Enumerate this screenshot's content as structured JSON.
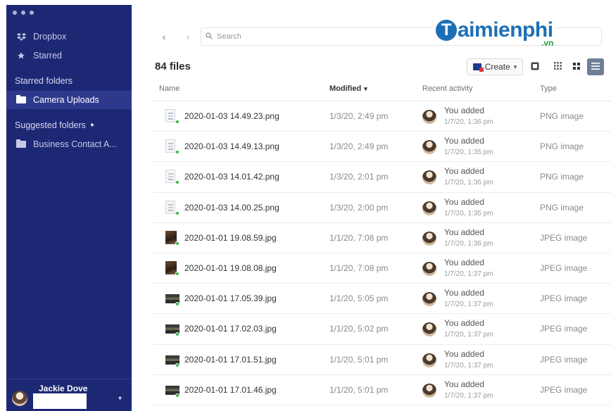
{
  "sidebar": {
    "items": [
      {
        "label": "Dropbox",
        "icon": "dropbox-icon"
      },
      {
        "label": "Starred",
        "icon": "star-icon"
      }
    ],
    "starred_header": "Starred folders",
    "starred_folders": [
      {
        "label": "Camera Uploads",
        "icon": "folder-icon"
      }
    ],
    "suggested_header": "Suggested folders",
    "suggested_folders": [
      {
        "label": "Business Contact A...",
        "icon": "folder-icon"
      }
    ],
    "user": {
      "name": "Jackie Dove"
    }
  },
  "toolbar": {
    "search_placeholder": "Search",
    "back_icon": "chevron-left-icon",
    "forward_icon": "chevron-right-icon"
  },
  "watermark": {
    "brand_rest": "aimienphi",
    "brand_letter": "T",
    "brand_sub": ".vn"
  },
  "header": {
    "file_count": "84 files",
    "create_label": "Create"
  },
  "columns": {
    "name": "Name",
    "modified": "Modified",
    "activity": "Recent activity",
    "type": "Type"
  },
  "files": [
    {
      "name": "2020-01-03 14.49.23.png",
      "modified": "1/3/20, 2:49 pm",
      "activity": "You added",
      "activity_time": "1/7/20, 1:36 pm",
      "type": "PNG image",
      "thumb": "doc"
    },
    {
      "name": "2020-01-03 14.49.13.png",
      "modified": "1/3/20, 2:49 pm",
      "activity": "You added",
      "activity_time": "1/7/20, 1:35 pm",
      "type": "PNG image",
      "thumb": "doc"
    },
    {
      "name": "2020-01-03 14.01.42.png",
      "modified": "1/3/20, 2:01 pm",
      "activity": "You added",
      "activity_time": "1/7/20, 1:36 pm",
      "type": "PNG image",
      "thumb": "doc"
    },
    {
      "name": "2020-01-03 14.00.25.png",
      "modified": "1/3/20, 2:00 pm",
      "activity": "You added",
      "activity_time": "1/7/20, 1:35 pm",
      "type": "PNG image",
      "thumb": "doc"
    },
    {
      "name": "2020-01-01 19.08.59.jpg",
      "modified": "1/1/20, 7:08 pm",
      "activity": "You added",
      "activity_time": "1/7/20, 1:36 pm",
      "type": "JPEG image",
      "thumb": "photo"
    },
    {
      "name": "2020-01-01 19.08.08.jpg",
      "modified": "1/1/20, 7:08 pm",
      "activity": "You added",
      "activity_time": "1/7/20, 1:37 pm",
      "type": "JPEG image",
      "thumb": "photo"
    },
    {
      "name": "2020-01-01 17.05.39.jpg",
      "modified": "1/1/20, 5:05 pm",
      "activity": "You added",
      "activity_time": "1/7/20, 1:37 pm",
      "type": "JPEG image",
      "thumb": "land"
    },
    {
      "name": "2020-01-01 17.02.03.jpg",
      "modified": "1/1/20, 5:02 pm",
      "activity": "You added",
      "activity_time": "1/7/20, 1:37 pm",
      "type": "JPEG image",
      "thumb": "land"
    },
    {
      "name": "2020-01-01 17.01.51.jpg",
      "modified": "1/1/20, 5:01 pm",
      "activity": "You added",
      "activity_time": "1/7/20, 1:37 pm",
      "type": "JPEG image",
      "thumb": "land"
    },
    {
      "name": "2020-01-01 17.01.46.jpg",
      "modified": "1/1/20, 5:01 pm",
      "activity": "You added",
      "activity_time": "1/7/20, 1:37 pm",
      "type": "JPEG image",
      "thumb": "land"
    }
  ],
  "colors": {
    "sidebar_bg": "#1d2875",
    "sidebar_active": "#2d3a8c",
    "brand": "#1d6fb5",
    "synced": "#3ab54a"
  }
}
